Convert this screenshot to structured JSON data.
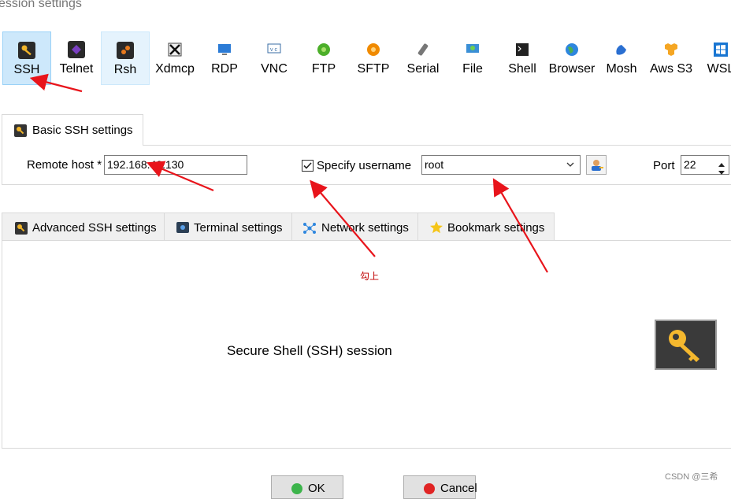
{
  "window": {
    "title": "ession settings"
  },
  "session_types": [
    {
      "label": "SSH",
      "icon": "key-icon",
      "color": "#f0b429"
    },
    {
      "label": "Telnet",
      "icon": "telnet-icon",
      "color": "#7a3fc1"
    },
    {
      "label": "Rsh",
      "icon": "rsh-icon",
      "color": "#e87a1d"
    },
    {
      "label": "Xdmcp",
      "icon": "xdmcp-icon",
      "color": "#555555"
    },
    {
      "label": "RDP",
      "icon": "rdp-icon",
      "color": "#2b7bd6"
    },
    {
      "label": "VNC",
      "icon": "vnc-icon",
      "color": "#3a6ea5"
    },
    {
      "label": "FTP",
      "icon": "ftp-icon",
      "color": "#4caf2a"
    },
    {
      "label": "SFTP",
      "icon": "sftp-icon",
      "color": "#f08a00"
    },
    {
      "label": "Serial",
      "icon": "serial-icon",
      "color": "#777777"
    },
    {
      "label": "File",
      "icon": "file-icon",
      "color": "#3a8fd6"
    },
    {
      "label": "Shell",
      "icon": "shell-icon",
      "color": "#222222"
    },
    {
      "label": "Browser",
      "icon": "globe-icon",
      "color": "#2e86de"
    },
    {
      "label": "Mosh",
      "icon": "satellite-icon",
      "color": "#2a6fd1"
    },
    {
      "label": "Aws S3",
      "icon": "aws-s3-icon",
      "color": "#f5a623"
    },
    {
      "label": "WSL",
      "icon": "windows-icon",
      "color": "#1976d2"
    }
  ],
  "basic_tab": {
    "label": "Basic SSH settings"
  },
  "basic": {
    "remote_host_label": "Remote host *",
    "remote_host_value": "192.168.40.130",
    "specify_username_label": "Specify username",
    "specify_username_checked": true,
    "username_value": "root",
    "port_label": "Port",
    "port_value": "22"
  },
  "lower_tabs": [
    {
      "label": "Advanced SSH settings",
      "icon": "key-icon"
    },
    {
      "label": "Terminal settings",
      "icon": "terminal-icon"
    },
    {
      "label": "Network settings",
      "icon": "network-icon"
    },
    {
      "label": "Bookmark settings",
      "icon": "star-icon"
    }
  ],
  "lower_panel": {
    "description": "Secure Shell (SSH) session"
  },
  "annotation": {
    "note": "勾上"
  },
  "buttons": {
    "ok_label": "OK",
    "cancel_label": "Cancel"
  },
  "watermark": "CSDN @三希"
}
